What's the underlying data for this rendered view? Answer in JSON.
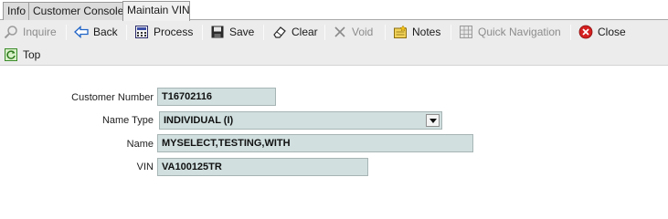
{
  "tabs": [
    {
      "label": "Info"
    },
    {
      "label": "Customer Console"
    },
    {
      "label": "Maintain VIN"
    }
  ],
  "toolbar": {
    "inquire": "Inquire",
    "back": "Back",
    "process": "Process",
    "save": "Save",
    "clear": "Clear",
    "void": "Void",
    "notes": "Notes",
    "quick_navigation": "Quick Navigation",
    "close": "Close",
    "top": "Top"
  },
  "form": {
    "customer_number": {
      "label": "Customer Number",
      "value": "T16702116"
    },
    "name_type": {
      "label": "Name Type",
      "value": "INDIVIDUAL (I)"
    },
    "name": {
      "label": "Name",
      "value": "MYSELECT,TESTING,WITH"
    },
    "vin": {
      "label": "VIN",
      "value": "VA100125TR"
    }
  },
  "colors": {
    "field_background": "#d1dfdf",
    "toolbar_background": "#ececec",
    "close_icon": "#d42020"
  }
}
